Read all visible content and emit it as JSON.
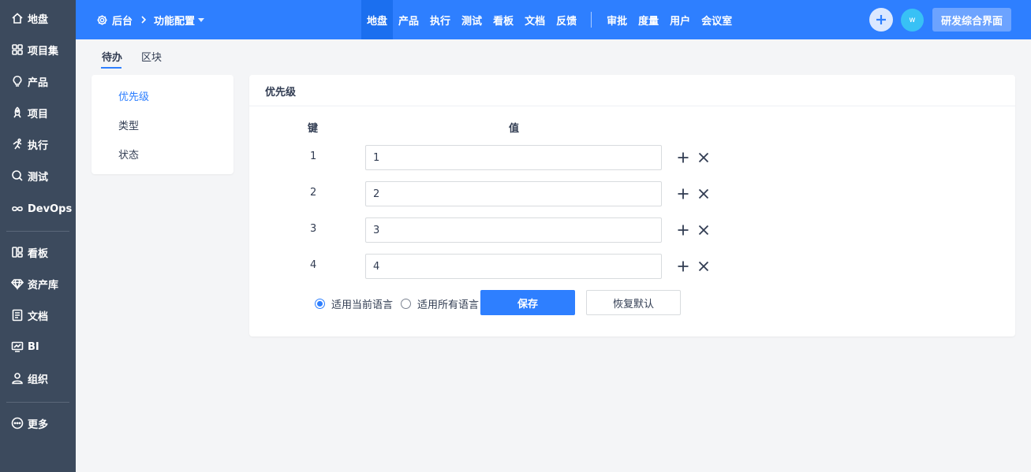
{
  "sidebar": {
    "items": [
      {
        "label": "地盘",
        "icon": "home-icon"
      },
      {
        "label": "项目集",
        "icon": "grid-icon"
      },
      {
        "label": "产品",
        "icon": "bulb-icon"
      },
      {
        "label": "项目",
        "icon": "rocket-icon"
      },
      {
        "label": "执行",
        "icon": "run-icon"
      },
      {
        "label": "测试",
        "icon": "search-icon"
      },
      {
        "label": "DevOps",
        "icon": "infinity-icon"
      },
      {
        "label": "看板",
        "icon": "kanban-icon"
      },
      {
        "label": "资产库",
        "icon": "diamond-icon"
      },
      {
        "label": "文档",
        "icon": "document-icon"
      },
      {
        "label": "BI",
        "icon": "monitor-icon"
      },
      {
        "label": "组织",
        "icon": "user-icon"
      },
      {
        "label": "更多",
        "icon": "more-icon"
      }
    ]
  },
  "header": {
    "breadcrumb_root": "后台",
    "breadcrumb_current": "功能配置",
    "nav": [
      "地盘",
      "产品",
      "执行",
      "测试",
      "看板",
      "文档",
      "反馈"
    ],
    "nav2": [
      "审批",
      "度量",
      "用户",
      "会议室"
    ],
    "avatar_text": "w",
    "switch_label": "研发综合界面"
  },
  "subtabs": [
    "待办",
    "区块"
  ],
  "left_menu": [
    "优先级",
    "类型",
    "状态"
  ],
  "panel": {
    "title": "优先级",
    "col_key": "键",
    "col_value": "值",
    "rows": [
      {
        "key": "1",
        "value": "1"
      },
      {
        "key": "2",
        "value": "2"
      },
      {
        "key": "3",
        "value": "3"
      },
      {
        "key": "4",
        "value": "4"
      }
    ],
    "radio_current": "适用当前语言",
    "radio_all": "适用所有语言",
    "save_label": "保存",
    "reset_label": "恢复默认"
  },
  "colors": {
    "primary": "#2e7fff",
    "sidebar_bg": "#3c4a5d",
    "page_bg": "#f4f5f7"
  }
}
